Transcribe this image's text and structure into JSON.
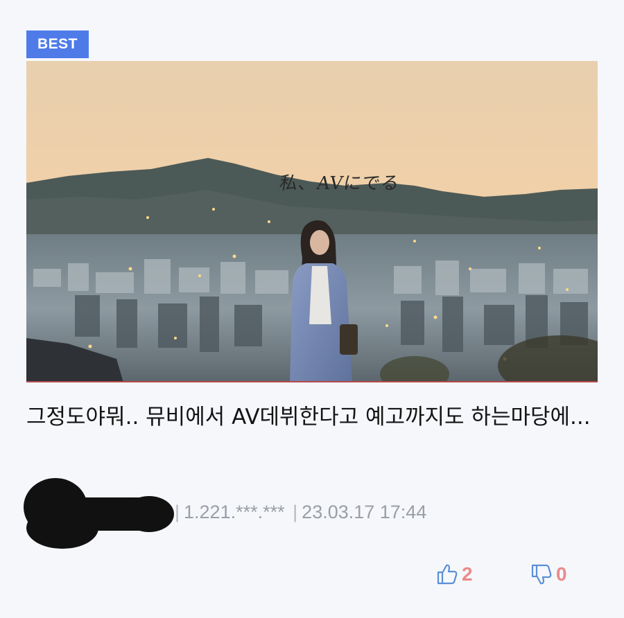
{
  "badge": {
    "label": "BEST"
  },
  "thumbnail": {
    "caption": "私、AVにでる"
  },
  "post": {
    "title": "그정도야뭐.. 뮤비에서 AV데뷔한다고 예고까지도 하는마당에...",
    "ip": "1.221.***.***",
    "date": "23.03.17 17:44"
  },
  "votes": {
    "up": "2",
    "down": "0"
  },
  "icons": {
    "upvote": "thumbs-up-icon",
    "downvote": "thumbs-down-icon"
  },
  "colors": {
    "badge": "#4f7be9",
    "vote_icon": "#5b8fd6",
    "vote_count": "#ea8a8a",
    "meta_text": "#9a9ea6"
  }
}
